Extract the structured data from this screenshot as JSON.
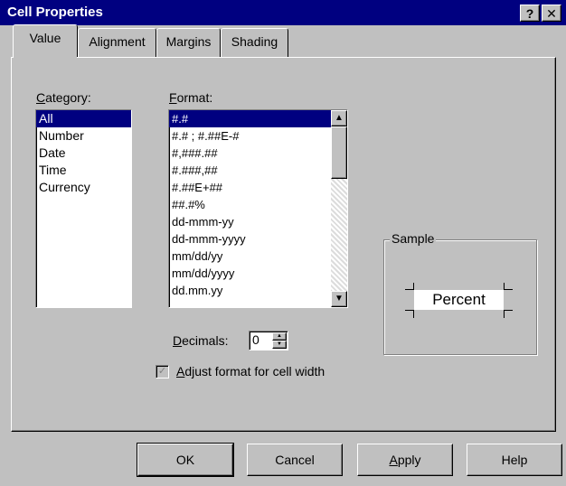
{
  "window": {
    "title": "Cell Properties",
    "help_glyph": "?",
    "close_glyph": "✕"
  },
  "tabs": [
    {
      "label": "Value",
      "active": true
    },
    {
      "label": "Alignment",
      "active": false
    },
    {
      "label": "Margins",
      "active": false
    },
    {
      "label": "Shading",
      "active": false
    }
  ],
  "category": {
    "label_first": "C",
    "label_rest": "ategory:",
    "items": [
      "All",
      "Number",
      "Date",
      "Time",
      "Currency"
    ],
    "selected": "All"
  },
  "format": {
    "label_first": "F",
    "label_rest": "ormat:",
    "items": [
      "#.#",
      "#.# ; #.##E-#",
      "#,###.##",
      "#.###,##",
      "#.##E+##",
      "##.#%",
      "dd-mmm-yy",
      "dd-mmm-yyyy",
      "mm/dd/yy",
      "mm/dd/yyyy",
      "dd.mm.yy"
    ],
    "selected": "#.#"
  },
  "decimals": {
    "label_first": "D",
    "label_rest": "ecimals:",
    "value": "0"
  },
  "adjust": {
    "label_first": "A",
    "label_rest": "djust format for cell width",
    "checked": true,
    "check_glyph": "✓"
  },
  "sample": {
    "legend": "Sample",
    "text": "Percent"
  },
  "buttons": {
    "ok": "OK",
    "cancel": "Cancel",
    "apply_first": "A",
    "apply_rest": "pply",
    "help": "Help"
  },
  "icons": {
    "up": "up-arrow-icon",
    "down": "down-arrow-icon"
  },
  "colors": {
    "titlebar": "#000080",
    "face": "#c0c0c0",
    "selection": "#000080"
  }
}
